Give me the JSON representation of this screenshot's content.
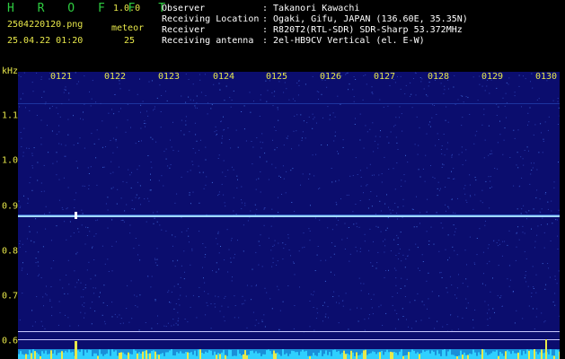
{
  "header": {
    "app_title": "H R O F F T",
    "version": "1.0.0",
    "filename": "2504220120.png",
    "datetime": "25.04.22 01:20",
    "meteor_label": "meteor",
    "meteor_count": "25"
  },
  "info": [
    {
      "key": "Observer",
      "value": ": Takanori Kawachi"
    },
    {
      "key": "Receiving Location",
      "value": ": Ogaki, Gifu, JAPAN (136.60E, 35.35N)"
    },
    {
      "key": "Receiver",
      "value": ": R820T2(RTL-SDR) SDR-Sharp 53.372MHz"
    },
    {
      "key": "Receiving antenna",
      "value": ": 2el-HB9CV Vertical (el. E-W)"
    }
  ],
  "axis": {
    "unit": "kHz",
    "time_ticks": [
      "0121",
      "0122",
      "0123",
      "0124",
      "0125",
      "0126",
      "0127",
      "0128",
      "0129",
      "0130"
    ],
    "freq_ticks": [
      "1.1",
      "1.0",
      "0.9",
      "0.8",
      "0.7",
      "0.6"
    ]
  },
  "colors": {
    "background": "#0b0d6e",
    "carrier": "#9fd8ff",
    "labels": "#e8e84a",
    "title": "#2ecc40"
  }
}
